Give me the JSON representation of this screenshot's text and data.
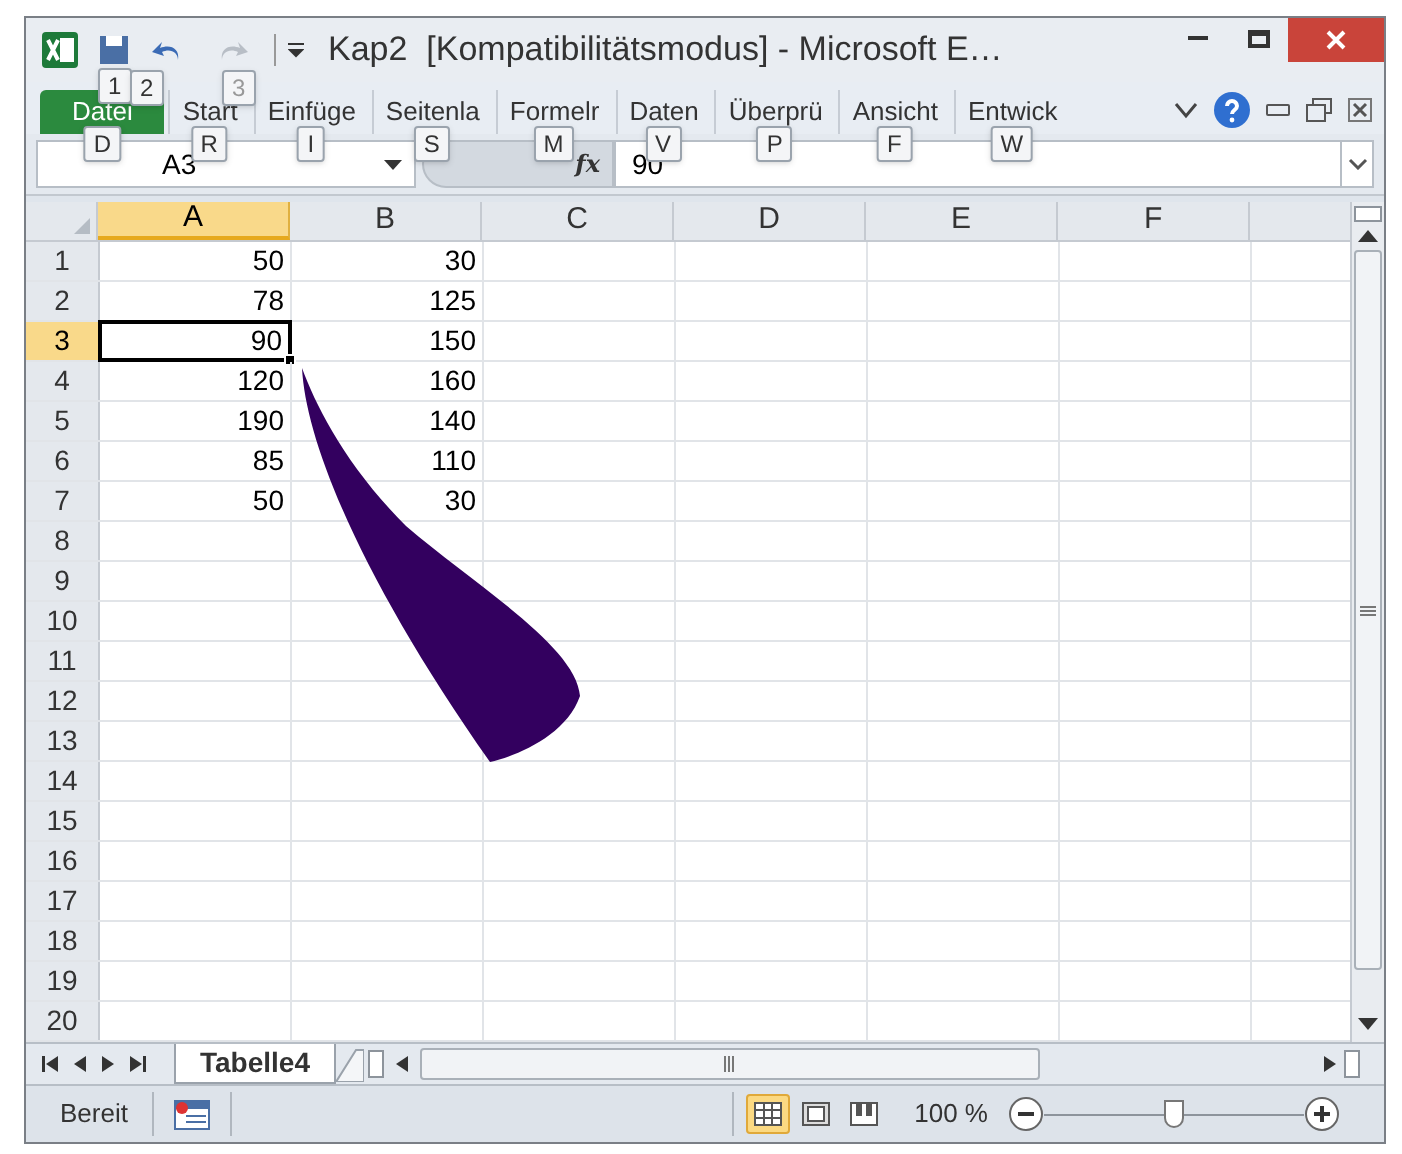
{
  "title_bar": {
    "title": "Kap2  [Kompatibilitätsmodus] - Microsoft E…",
    "quick_access_keytips": [
      "1",
      "2",
      "3"
    ]
  },
  "ribbon_tabs": [
    {
      "label": "Datei",
      "keytip": "D",
      "selected": true
    },
    {
      "label": "Start",
      "keytip": "R",
      "selected": false
    },
    {
      "label": "Einfüge",
      "keytip": "I",
      "selected": false
    },
    {
      "label": "Seitenla",
      "keytip": "S",
      "selected": false
    },
    {
      "label": "Formelr",
      "keytip": "M",
      "selected": false
    },
    {
      "label": "Daten",
      "keytip": "V",
      "selected": false
    },
    {
      "label": "Überprü",
      "keytip": "P",
      "selected": false
    },
    {
      "label": "Ansicht",
      "keytip": "F",
      "selected": false
    },
    {
      "label": "Entwick",
      "keytip": "W",
      "selected": false
    }
  ],
  "formula_bar": {
    "name_box": "A3",
    "fx": "fx",
    "value": "90"
  },
  "columns": [
    {
      "label": "A",
      "selected": true
    },
    {
      "label": "B",
      "selected": false
    },
    {
      "label": "C",
      "selected": false
    },
    {
      "label": "D",
      "selected": false
    },
    {
      "label": "E",
      "selected": false
    },
    {
      "label": "F",
      "selected": false
    }
  ],
  "rows": [
    {
      "label": "1",
      "selected": false,
      "cells": [
        {
          "value": "50",
          "selected": false
        },
        {
          "value": "30",
          "selected": false
        }
      ]
    },
    {
      "label": "2",
      "selected": false,
      "cells": [
        {
          "value": "78",
          "selected": false
        },
        {
          "value": "125",
          "selected": false
        }
      ]
    },
    {
      "label": "3",
      "selected": true,
      "cells": [
        {
          "value": "90",
          "selected": true
        },
        {
          "value": "150",
          "selected": false
        }
      ]
    },
    {
      "label": "4",
      "selected": false,
      "cells": [
        {
          "value": "120",
          "selected": false
        },
        {
          "value": "160",
          "selected": false
        }
      ]
    },
    {
      "label": "5",
      "selected": false,
      "cells": [
        {
          "value": "190",
          "selected": false
        },
        {
          "value": "140",
          "selected": false
        }
      ]
    },
    {
      "label": "6",
      "selected": false,
      "cells": [
        {
          "value": "85",
          "selected": false
        },
        {
          "value": "110",
          "selected": false
        }
      ]
    },
    {
      "label": "7",
      "selected": false,
      "cells": [
        {
          "value": "50",
          "selected": false
        },
        {
          "value": "30",
          "selected": false
        }
      ]
    },
    {
      "label": "8",
      "selected": false
    },
    {
      "label": "9",
      "selected": false
    },
    {
      "label": "10",
      "selected": false
    },
    {
      "label": "11",
      "selected": false
    },
    {
      "label": "12",
      "selected": false
    },
    {
      "label": "13",
      "selected": false
    },
    {
      "label": "14",
      "selected": false
    },
    {
      "label": "15",
      "selected": false
    },
    {
      "label": "16",
      "selected": false
    },
    {
      "label": "17",
      "selected": false
    },
    {
      "label": "18",
      "selected": false
    },
    {
      "label": "19",
      "selected": false
    },
    {
      "label": "20",
      "selected": false
    }
  ],
  "sheet_tabs": [
    {
      "label": "Tabelle4",
      "selected": true
    }
  ],
  "status_bar": {
    "status": "Bereit",
    "view_buttons": [
      {
        "kind": "normal",
        "selected": true
      },
      {
        "kind": "layout",
        "selected": false
      },
      {
        "kind": "pagebreak",
        "selected": false
      }
    ],
    "zoom": "100 %",
    "zoom_slider": {
      "level": 0.5
    }
  }
}
